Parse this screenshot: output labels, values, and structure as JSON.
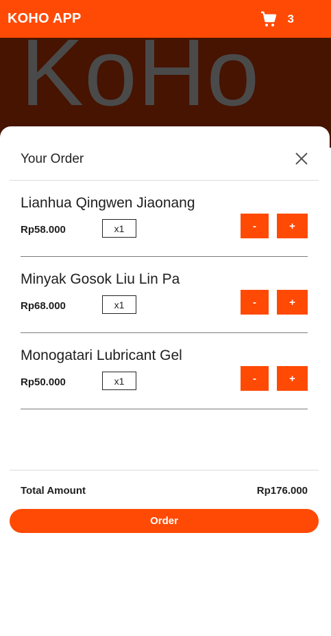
{
  "colors": {
    "accent": "#ff4a05",
    "hero_bg": "#461401"
  },
  "topbar": {
    "brand": "KOHO APP",
    "cart_icon": "cart-icon",
    "cart_count": "3"
  },
  "hero": {
    "text": "KoHo"
  },
  "modal": {
    "title": "Your Order",
    "close_icon": "close-icon",
    "items": [
      {
        "name": "Lianhua Qingwen Jiaonang",
        "price": "Rp58.000",
        "qty": "x1",
        "minus": "-",
        "plus": "+"
      },
      {
        "name": "Minyak Gosok Liu Lin Pa",
        "price": "Rp68.000",
        "qty": "x1",
        "minus": "-",
        "plus": "+"
      },
      {
        "name": "Monogatari Lubricant Gel",
        "price": "Rp50.000",
        "qty": "x1",
        "minus": "-",
        "plus": "+"
      }
    ],
    "total_label": "Total Amount",
    "total_value": "Rp176.000",
    "order_label": "Order"
  }
}
